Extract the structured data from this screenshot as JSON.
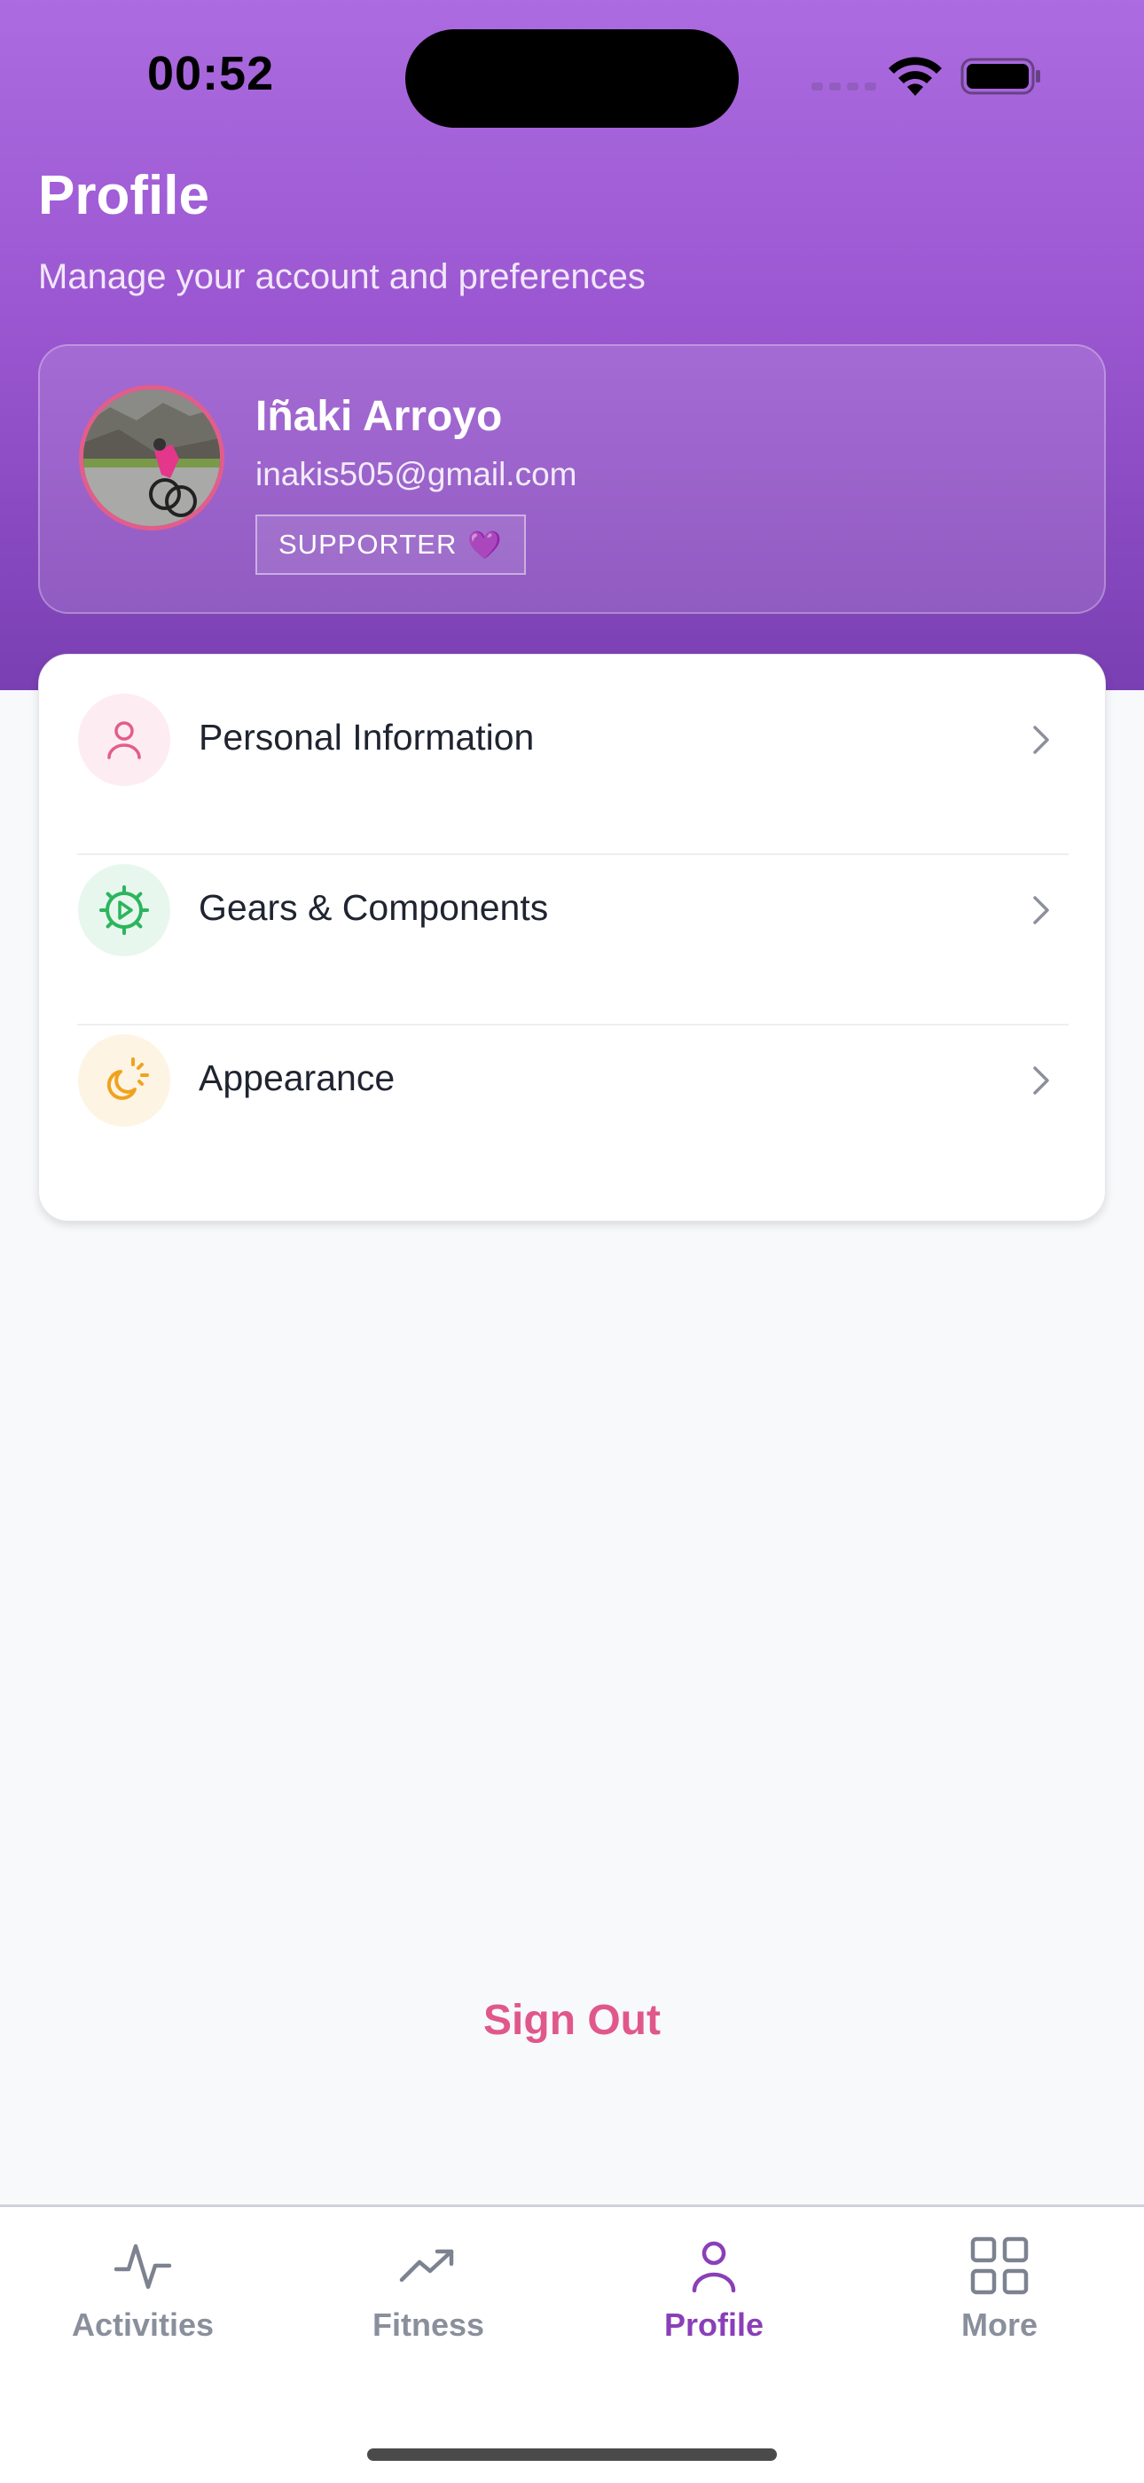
{
  "status_bar": {
    "time": "00:52"
  },
  "header": {
    "title": "Profile",
    "subtitle": "Manage your account and preferences"
  },
  "profile": {
    "name": "Iñaki Arroyo",
    "email": "inakis505@gmail.com",
    "badge": "SUPPORTER",
    "badge_emoji": "💜"
  },
  "menu": {
    "items": [
      {
        "label": "Personal Information",
        "icon": "person-icon",
        "color": "#e35d8a"
      },
      {
        "label": "Gears & Components",
        "icon": "gear-play-icon",
        "color": "#2cb55d"
      },
      {
        "label": "Appearance",
        "icon": "moon-sun-icon",
        "color": "#f0a21f"
      }
    ]
  },
  "sign_out": {
    "label": "Sign Out"
  },
  "tab_bar": {
    "tabs": [
      {
        "label": "Activities",
        "icon": "activity-pulse-icon"
      },
      {
        "label": "Fitness",
        "icon": "trending-up-icon"
      },
      {
        "label": "Profile",
        "icon": "person-icon"
      },
      {
        "label": "More",
        "icon": "grid-icon"
      }
    ],
    "active": "Profile"
  },
  "colors": {
    "accent": "#8a3fb8",
    "header_gradient_top": "#ac6be0",
    "header_gradient_bottom": "#7a3fb3",
    "sign_out": "#e0588a"
  }
}
